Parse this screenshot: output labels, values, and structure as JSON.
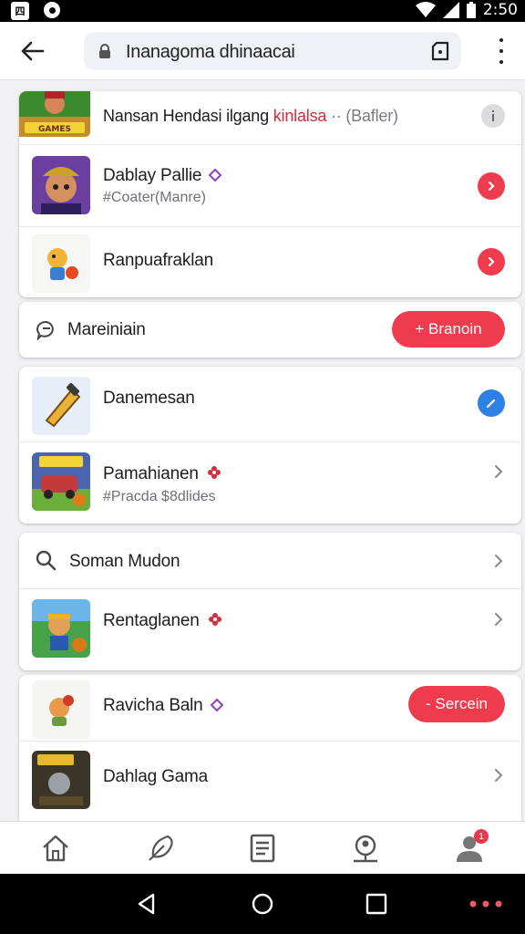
{
  "status_bar": {
    "time": "2:50",
    "left_icons": [
      "notification-box-icon",
      "record-icon"
    ],
    "right_icons": [
      "wifi-icon",
      "signal-icon",
      "battery-icon"
    ],
    "box_glyph": "四"
  },
  "address_bar": {
    "url": "Inanagoma dhinaacai",
    "icons": [
      "back-arrow-icon",
      "lock-icon",
      "tab-switcher-icon",
      "overflow-menu-icon"
    ]
  },
  "cards": [
    {
      "rows": [
        {
          "title": "Nansan Hendasi ilgang",
          "highlight": "kinlalsa",
          "suffix": "·· (Bafler)",
          "action": "info-icon"
        },
        {
          "title": "Dablay Pallie",
          "badge": "purple-gem-icon",
          "subtitle": "#Coater(Manre)",
          "action": "red-arrow-button"
        },
        {
          "title": "Ranpuafraklan",
          "action": "red-arrow-button"
        }
      ]
    },
    {
      "rows": [
        {
          "title": "Mareiniain",
          "icon": "chat-bubble-icon",
          "button_label": "+ Branoin"
        }
      ]
    },
    {
      "rows": [
        {
          "title": "Danemesan",
          "action": "blue-edit-button"
        },
        {
          "title": "Pamahianen",
          "badge": "red-flower-icon",
          "subtitle": "#Pracda $8dlides",
          "action": "chevron-right-icon"
        }
      ]
    },
    {
      "rows": [
        {
          "title": "Soman Mudon",
          "icon": "search-icon",
          "action": "chevron-right-icon"
        },
        {
          "title": "Rentaglanen",
          "badge": "red-flower-icon",
          "action": "chevron-right-icon"
        }
      ]
    },
    {
      "rows": [
        {
          "title": "Ravicha Baln",
          "badge": "purple-gem-icon",
          "button_label": "- Sercein"
        },
        {
          "title": "Dahlag Gama",
          "action": "chevron-right-icon"
        }
      ]
    }
  ],
  "bottom_nav": {
    "items": [
      "home-icon",
      "feather-icon",
      "document-icon",
      "person-pin-icon",
      "profile-icon"
    ],
    "profile_badge": "1"
  },
  "system_nav": {
    "items": [
      "back-triangle-icon",
      "home-circle-icon",
      "recents-square-icon",
      "more-dots-icon"
    ]
  },
  "colors": {
    "accent_red": "#ef3b4e",
    "accent_blue": "#2f80e4",
    "purple": "#8a3fc7"
  }
}
